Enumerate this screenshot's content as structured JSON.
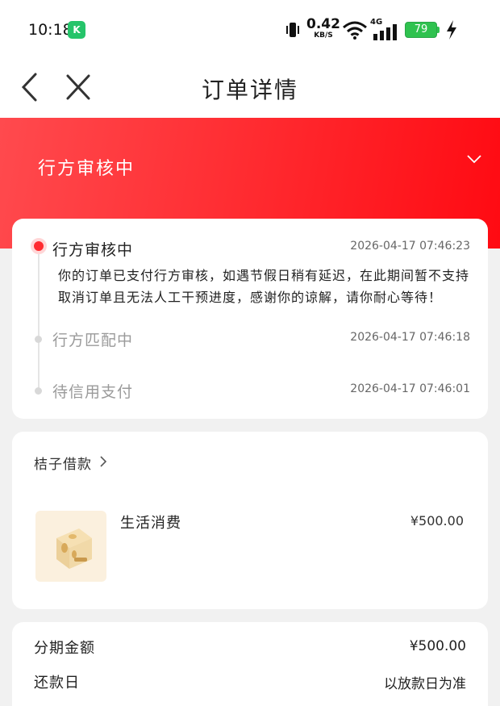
{
  "status_bar": {
    "time": "10:18",
    "app_badge_glyph": "K",
    "net_speed": "0.42",
    "net_speed_unit": "KB/S",
    "network_type": "4G",
    "battery": "79"
  },
  "nav": {
    "title": "订单详情",
    "back_icon": "chevron-left-icon",
    "close_icon": "close-icon"
  },
  "banner": {
    "status": "行方审核中",
    "icon": "chevron-down-icon"
  },
  "timeline": [
    {
      "title": "行方审核中",
      "time": "2026-04-17 07:46:23",
      "desc": "你的订单已支付行方审核，如遇节假日稍有延迟，在此期间暂不支持取消订单且无法人工干预进度，感谢你的谅解，请你耐心等待！",
      "active": true
    },
    {
      "title": "行方匹配中",
      "time": "2026-04-17 07:46:18",
      "active": false
    },
    {
      "title": "待信用支付",
      "time": "2026-04-17 07:46:01",
      "active": false
    }
  ],
  "loan": {
    "header": "桔子借款",
    "product_name": "生活消费",
    "product_price": "¥500.00"
  },
  "summary": {
    "installment_label": "分期金额",
    "installment_value": "¥500.00",
    "repay_label": "还款日",
    "repay_value": "以放款日为准"
  },
  "colors": {
    "accent_red": "#ff2b30",
    "status_green": "#2fc24f"
  }
}
